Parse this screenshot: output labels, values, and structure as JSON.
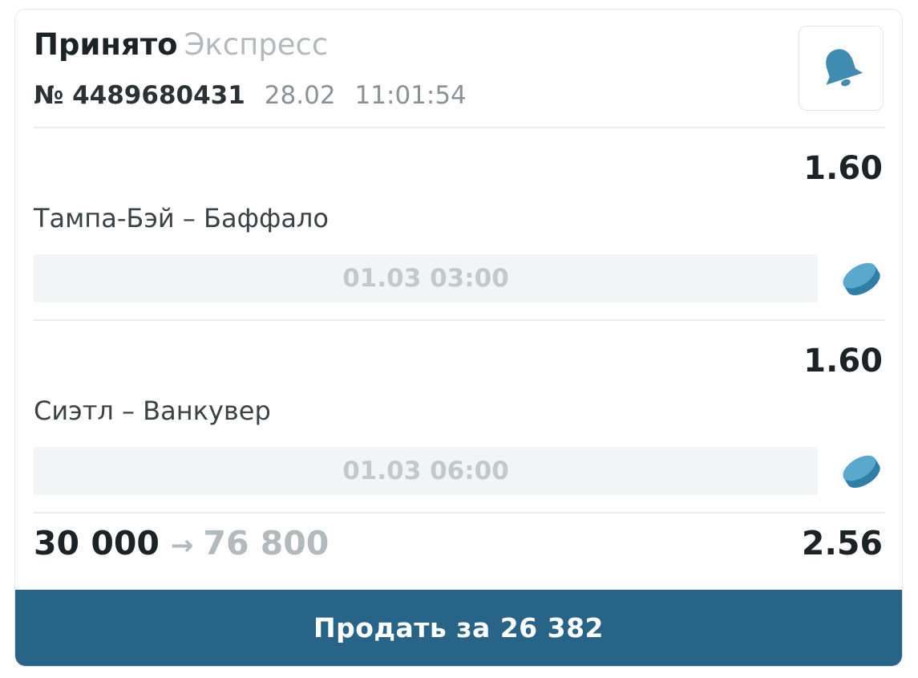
{
  "header": {
    "status": "Принято",
    "bet_type": "Экспресс",
    "bet_number": "№ 4489680431",
    "date": "28.02",
    "time": "11:01:54",
    "bell_icon": "bell-icon"
  },
  "events": [
    {
      "odds": "1.60",
      "teams": "Тампа-Бэй – Баффало",
      "start_time": "01.03 03:00",
      "sport_icon": "hockey-puck-icon"
    },
    {
      "odds": "1.60",
      "teams": "Сиэтл – Ванкувер",
      "start_time": "01.03 06:00",
      "sport_icon": "hockey-puck-icon"
    }
  ],
  "totals": {
    "stake": "30 000",
    "arrow": "→",
    "payout": "76 800",
    "total_odds": "2.56"
  },
  "sell_button": {
    "label": "Продать за 26 382"
  },
  "colors": {
    "accent": "#286487",
    "icon": "#3f8cb0",
    "muted_text": "#b3babd",
    "primary_text": "#1c2326"
  }
}
